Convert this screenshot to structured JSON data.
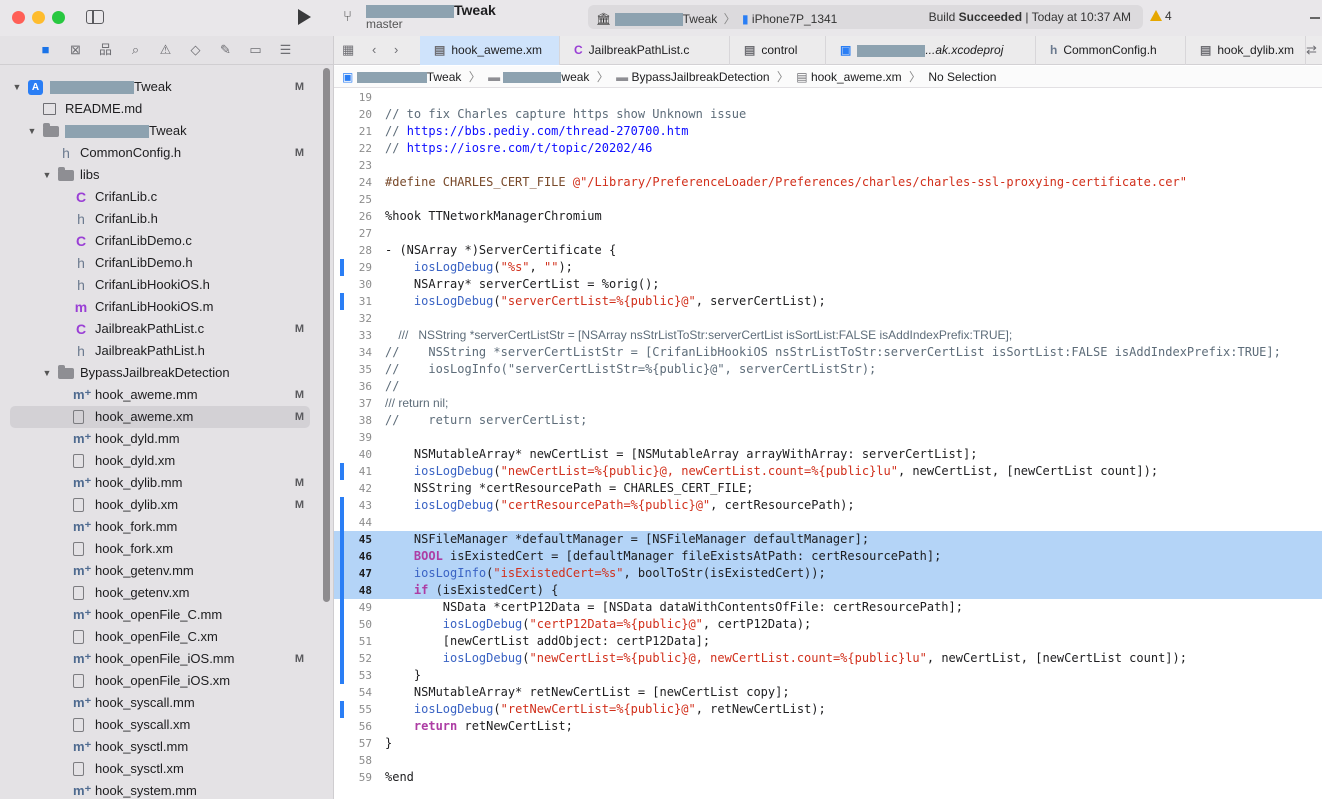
{
  "titlebar": {
    "project_suffix": "Tweak",
    "branch": "master",
    "scheme_suffix": "Tweak",
    "device": "iPhone7P_1341",
    "build_word": "Build ",
    "build_result": "Succeeded",
    "build_time": " | Today at 10:37 AM",
    "warnings": "4"
  },
  "sidebar": {
    "items": [
      {
        "label": "Tweak",
        "redacted": true,
        "badge": "M",
        "depth": 0,
        "icon": "app",
        "disclosure": "▼"
      },
      {
        "label": "README.md",
        "badge": "",
        "depth": 1,
        "icon": "book",
        "disclosure": ""
      },
      {
        "label": "Tweak",
        "redacted": true,
        "badge": "",
        "depth": 1,
        "icon": "folder",
        "disclosure": "▼"
      },
      {
        "label": "CommonConfig.h",
        "badge": "M",
        "depth": 2,
        "icon": "h",
        "disclosure": ""
      },
      {
        "label": "libs",
        "badge": "",
        "depth": 2,
        "icon": "folder",
        "disclosure": "▼"
      },
      {
        "label": "CrifanLib.c",
        "badge": "",
        "depth": 3,
        "icon": "c",
        "disclosure": ""
      },
      {
        "label": "CrifanLib.h",
        "badge": "",
        "depth": 3,
        "icon": "h",
        "disclosure": ""
      },
      {
        "label": "CrifanLibDemo.c",
        "badge": "",
        "depth": 3,
        "icon": "c",
        "disclosure": ""
      },
      {
        "label": "CrifanLibDemo.h",
        "badge": "",
        "depth": 3,
        "icon": "h",
        "disclosure": ""
      },
      {
        "label": "CrifanLibHookiOS.h",
        "badge": "",
        "depth": 3,
        "icon": "h",
        "disclosure": ""
      },
      {
        "label": "CrifanLibHookiOS.m",
        "badge": "",
        "depth": 3,
        "icon": "m",
        "disclosure": ""
      },
      {
        "label": "JailbreakPathList.c",
        "badge": "M",
        "depth": 3,
        "icon": "c",
        "disclosure": ""
      },
      {
        "label": "JailbreakPathList.h",
        "badge": "",
        "depth": 3,
        "icon": "h",
        "disclosure": ""
      },
      {
        "label": "BypassJailbreakDetection",
        "badge": "",
        "depth": 2,
        "icon": "folder",
        "disclosure": "▼"
      },
      {
        "label": "hook_aweme.mm",
        "badge": "M",
        "depth": 3,
        "icon": "mm",
        "disclosure": ""
      },
      {
        "label": "hook_aweme.xm",
        "badge": "M",
        "depth": 3,
        "icon": "xm",
        "disclosure": "",
        "selected": true
      },
      {
        "label": "hook_dyld.mm",
        "badge": "",
        "depth": 3,
        "icon": "mm",
        "disclosure": ""
      },
      {
        "label": "hook_dyld.xm",
        "badge": "",
        "depth": 3,
        "icon": "xm",
        "disclosure": ""
      },
      {
        "label": "hook_dylib.mm",
        "badge": "M",
        "depth": 3,
        "icon": "mm",
        "disclosure": ""
      },
      {
        "label": "hook_dylib.xm",
        "badge": "M",
        "depth": 3,
        "icon": "xm",
        "disclosure": ""
      },
      {
        "label": "hook_fork.mm",
        "badge": "",
        "depth": 3,
        "icon": "mm",
        "disclosure": ""
      },
      {
        "label": "hook_fork.xm",
        "badge": "",
        "depth": 3,
        "icon": "xm",
        "disclosure": ""
      },
      {
        "label": "hook_getenv.mm",
        "badge": "",
        "depth": 3,
        "icon": "mm",
        "disclosure": ""
      },
      {
        "label": "hook_getenv.xm",
        "badge": "",
        "depth": 3,
        "icon": "xm",
        "disclosure": ""
      },
      {
        "label": "hook_openFile_C.mm",
        "badge": "",
        "depth": 3,
        "icon": "mm",
        "disclosure": ""
      },
      {
        "label": "hook_openFile_C.xm",
        "badge": "",
        "depth": 3,
        "icon": "xm",
        "disclosure": ""
      },
      {
        "label": "hook_openFile_iOS.mm",
        "badge": "M",
        "depth": 3,
        "icon": "mm",
        "disclosure": ""
      },
      {
        "label": "hook_openFile_iOS.xm",
        "badge": "",
        "depth": 3,
        "icon": "xm",
        "disclosure": ""
      },
      {
        "label": "hook_syscall.mm",
        "badge": "",
        "depth": 3,
        "icon": "mm",
        "disclosure": ""
      },
      {
        "label": "hook_syscall.xm",
        "badge": "",
        "depth": 3,
        "icon": "xm",
        "disclosure": ""
      },
      {
        "label": "hook_sysctl.mm",
        "badge": "",
        "depth": 3,
        "icon": "mm",
        "disclosure": ""
      },
      {
        "label": "hook_sysctl.xm",
        "badge": "",
        "depth": 3,
        "icon": "xm",
        "disclosure": ""
      },
      {
        "label": "hook_system.mm",
        "badge": "",
        "depth": 3,
        "icon": "mm",
        "disclosure": ""
      }
    ]
  },
  "tabs": [
    {
      "label": "hook_aweme.xm",
      "icon": "xm",
      "active": true
    },
    {
      "label": "JailbreakPathList.c",
      "icon": "c"
    },
    {
      "label": "control",
      "icon": "doc"
    },
    {
      "label": "...ak.xcodeproj",
      "icon": "app",
      "redacted": true
    },
    {
      "label": "CommonConfig.h",
      "icon": "h"
    },
    {
      "label": "hook_dylib.xm",
      "icon": "xm"
    }
  ],
  "jumpbar": {
    "project": "Tweak",
    "group": "weak",
    "folder": "BypassJailbreakDetection",
    "file": "hook_aweme.xm",
    "selection": "No Selection"
  },
  "code": {
    "lines": [
      {
        "n": "19",
        "t": ""
      },
      {
        "n": "20",
        "t": "// to fix Charles capture https show Unknown issue"
      },
      {
        "n": "21",
        "t": "// https://bbs.pediy.com/thread-270700.htm"
      },
      {
        "n": "22",
        "t": "// https://iosre.com/t/topic/20202/46"
      },
      {
        "n": "23",
        "t": ""
      },
      {
        "n": "24",
        "t": "#define CHARLES_CERT_FILE @\"/Library/PreferenceLoader/Preferences/charles/charles-ssl-proxying-certificate.cer\""
      },
      {
        "n": "25",
        "t": ""
      },
      {
        "n": "26",
        "t": "%hook TTNetworkManagerChromium"
      },
      {
        "n": "27",
        "t": ""
      },
      {
        "n": "28",
        "t": "- (NSArray *)ServerCertificate {"
      },
      {
        "n": "29",
        "t": "    iosLogDebug(\"%s\", \"\");"
      },
      {
        "n": "30",
        "t": "    NSArray* serverCertList = %orig();"
      },
      {
        "n": "31",
        "t": "    iosLogDebug(\"serverCertList=%{public}@\", serverCertList);"
      },
      {
        "n": "32",
        "t": ""
      },
      {
        "n": "33",
        "t": "    ///   NSString *serverCertListStr = [NSArray nsStrListToStr:serverCertList isSortList:FALSE isAddIndexPrefix:TRUE];"
      },
      {
        "n": "34",
        "t": "//    NSString *serverCertListStr = [CrifanLibHookiOS nsStrListToStr:serverCertList isSortList:FALSE isAddIndexPrefix:TRUE];"
      },
      {
        "n": "35",
        "t": "//    iosLogInfo(\"serverCertListStr=%{public}@\", serverCertListStr);"
      },
      {
        "n": "36",
        "t": "//"
      },
      {
        "n": "37",
        "t": "/// return nil;"
      },
      {
        "n": "38",
        "t": "//    return serverCertList;"
      },
      {
        "n": "39",
        "t": ""
      },
      {
        "n": "40",
        "t": "    NSMutableArray* newCertList = [NSMutableArray arrayWithArray: serverCertList];"
      },
      {
        "n": "41",
        "t": "    iosLogDebug(\"newCertList=%{public}@, newCertList.count=%{public}lu\", newCertList, [newCertList count]);"
      },
      {
        "n": "42",
        "t": "    NSString *certResourcePath = CHARLES_CERT_FILE;"
      },
      {
        "n": "43",
        "t": "    iosLogDebug(\"certResourcePath=%{public}@\", certResourcePath);"
      },
      {
        "n": "44",
        "t": ""
      },
      {
        "n": "45",
        "t": "    NSFileManager *defaultManager = [NSFileManager defaultManager];"
      },
      {
        "n": "46",
        "t": "    BOOL isExistedCert = [defaultManager fileExistsAtPath: certResourcePath];"
      },
      {
        "n": "47",
        "t": "    iosLogInfo(\"isExistedCert=%s\", boolToStr(isExistedCert));"
      },
      {
        "n": "48",
        "t": "    if (isExistedCert) {"
      },
      {
        "n": "49",
        "t": "        NSData *certP12Data = [NSData dataWithContentsOfFile: certResourcePath];"
      },
      {
        "n": "50",
        "t": "        iosLogDebug(\"certP12Data=%{public}@\", certP12Data);"
      },
      {
        "n": "51",
        "t": "        [newCertList addObject: certP12Data];"
      },
      {
        "n": "52",
        "t": "        iosLogDebug(\"newCertList=%{public}@, newCertList.count=%{public}lu\", newCertList, [newCertList count]);"
      },
      {
        "n": "53",
        "t": "    }"
      },
      {
        "n": "54",
        "t": "    NSMutableArray* retNewCertList = [newCertList copy];"
      },
      {
        "n": "55",
        "t": "    iosLogDebug(\"retNewCertList=%{public}@\", retNewCertList);"
      },
      {
        "n": "56",
        "t": "    return retNewCertList;"
      },
      {
        "n": "57",
        "t": "}"
      },
      {
        "n": "58",
        "t": ""
      },
      {
        "n": "59",
        "t": "%end"
      }
    ],
    "highlighted_lines": [
      "45",
      "46",
      "47",
      "48"
    ],
    "changed_lines": [
      "29",
      "31",
      "41",
      "43",
      "44",
      "45",
      "46",
      "47",
      "48",
      "49",
      "50",
      "51",
      "52",
      "53",
      "55"
    ],
    "proportional_lines": [
      "33",
      "37"
    ]
  },
  "colors": {
    "selection": "#b4d4f7",
    "change_bar": "#2a7ef5",
    "keyword": "#ad3da4",
    "string": "#d12f1b",
    "function": "#3a63c4",
    "url": "#0e0eff"
  }
}
